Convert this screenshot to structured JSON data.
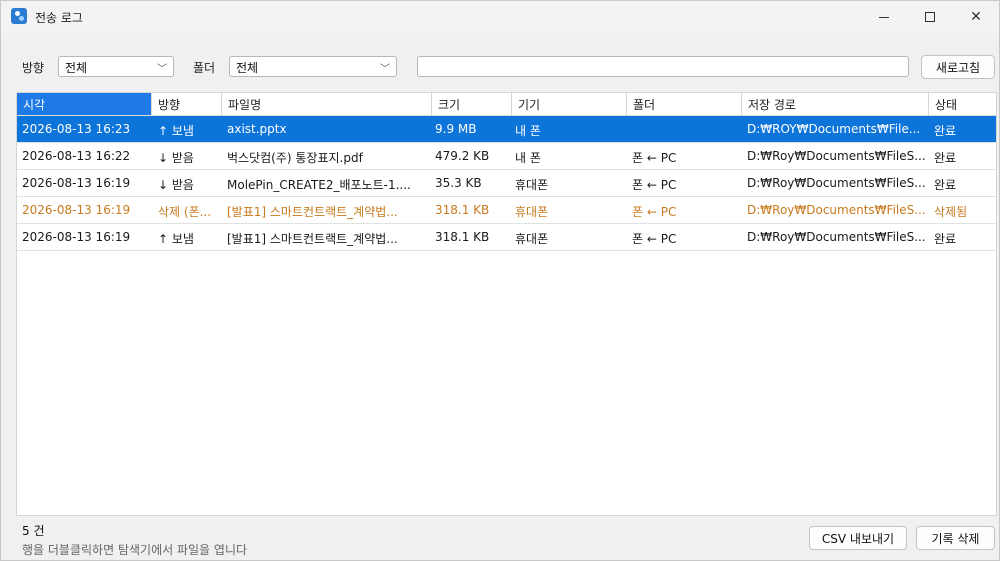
{
  "window": {
    "title": "전송 로그"
  },
  "filters": {
    "direction_label": "방향",
    "direction_value": "전체",
    "folder_label": "폴더",
    "folder_value": "전체",
    "search_value": "",
    "refresh_label": "새로고침"
  },
  "table": {
    "columns": [
      "시각",
      "방향",
      "파일명",
      "크기",
      "기기",
      "폴더",
      "저장 경로",
      "상태"
    ],
    "rows": [
      {
        "time": "2026-08-13 16:23",
        "direction": "↑ 보냄",
        "filename": "axist.pptx",
        "size": "9.9 MB",
        "device": "내 폰",
        "folder": "",
        "path": "D:₩ROY₩Documents₩File...",
        "status": "완료",
        "selected": true,
        "deleted": false
      },
      {
        "time": "2026-08-13 16:22",
        "direction": "↓ 받음",
        "filename": "벅스닷컴(주) 통장표지.pdf",
        "size": "479.2 KB",
        "device": "내 폰",
        "folder": "폰 ← PC",
        "path": "D:₩Roy₩Documents₩FileS...",
        "status": "완료",
        "selected": false,
        "deleted": false
      },
      {
        "time": "2026-08-13 16:19",
        "direction": "↓ 받음",
        "filename": "MolePin_CREATE2_배포노트-1....",
        "size": "35.3 KB",
        "device": "휴대폰",
        "folder": "폰 ← PC",
        "path": "D:₩Roy₩Documents₩FileS...",
        "status": "완료",
        "selected": false,
        "deleted": false
      },
      {
        "time": "2026-08-13 16:19",
        "direction": "삭제 (폰...",
        "filename": "[발표1] 스마트컨트랙트_계약법...",
        "size": "318.1 KB",
        "device": "휴대폰",
        "folder": "폰 ← PC",
        "path": "D:₩Roy₩Documents₩FileS...",
        "status": "삭제됨",
        "selected": false,
        "deleted": true
      },
      {
        "time": "2026-08-13 16:19",
        "direction": "↑ 보냄",
        "filename": "[발표1] 스마트컨트랙트_계약법...",
        "size": "318.1 KB",
        "device": "휴대폰",
        "folder": "폰 ← PC",
        "path": "D:₩Roy₩Documents₩FileS...",
        "status": "완료",
        "selected": false,
        "deleted": false
      }
    ]
  },
  "footer": {
    "count": "5 건",
    "hint": "행을 더블클릭하면 탐색기에서 파일을 엽니다",
    "csv_export_label": "CSV 내보내기",
    "delete_log_label": "기록 삭제"
  }
}
